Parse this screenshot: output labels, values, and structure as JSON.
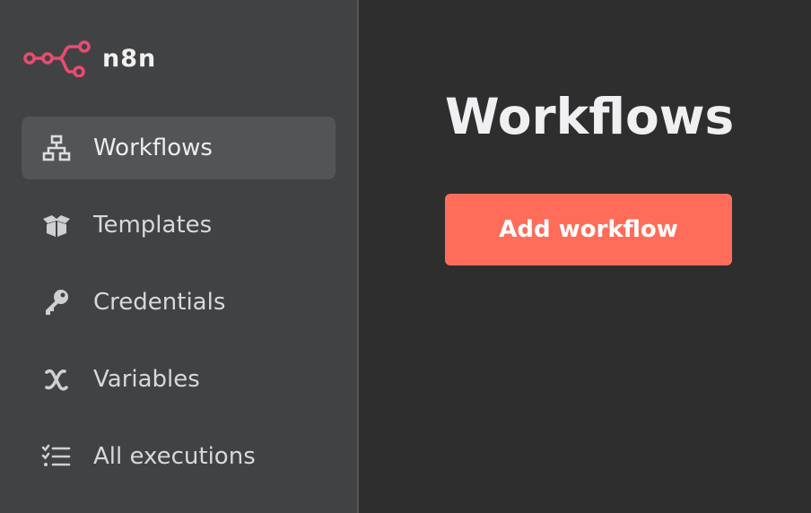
{
  "brand": {
    "name": "n8n",
    "accent_color": "#ea4b71"
  },
  "sidebar": {
    "items": [
      {
        "label": "Workflows",
        "icon": "network-icon",
        "active": true
      },
      {
        "label": "Templates",
        "icon": "box-open-icon",
        "active": false
      },
      {
        "label": "Credentials",
        "icon": "key-icon",
        "active": false
      },
      {
        "label": "Variables",
        "icon": "variable-x-icon",
        "active": false
      },
      {
        "label": "All executions",
        "icon": "tasks-list-icon",
        "active": false
      }
    ]
  },
  "main": {
    "title": "Workflows",
    "add_button_label": "Add workflow",
    "button_color": "#ff6d5a"
  }
}
